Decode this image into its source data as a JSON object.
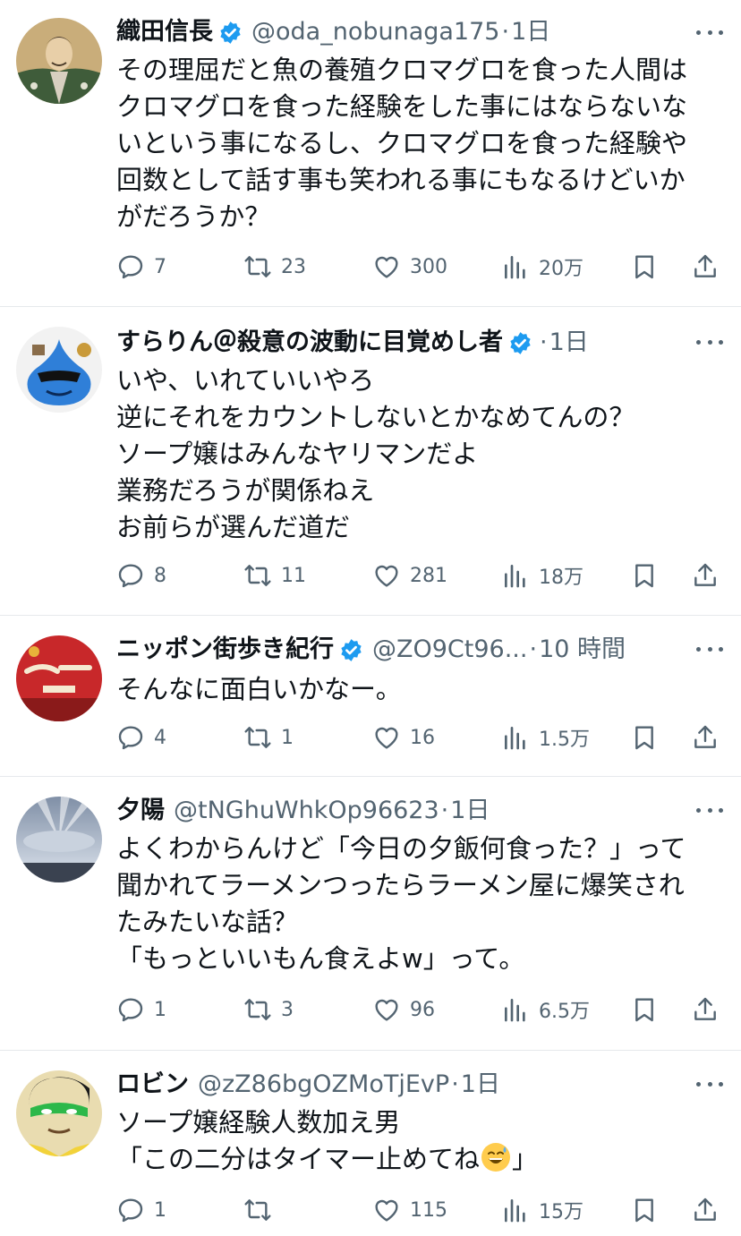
{
  "tweets": [
    {
      "name": "織田信長",
      "verified": true,
      "handle": "@oda_nobunaga175",
      "sep": "·",
      "time": "1日",
      "text": "その理屈だと魚の養殖クロマグロを食った人間は\nクロマグロを食った経験をした事にはならないな\nいという事になるし、クロマグロを食った経験や\n回数として話す事も笑われる事にもなるけどいか\nがだろうか？",
      "replies": "7",
      "retweets": "23",
      "likes": "300",
      "views": "20万",
      "avatar_icon": "samurai-portrait"
    },
    {
      "name": "すらりん＠殺意の波動に目覚めし者",
      "verified": true,
      "handle": "",
      "sep": "·",
      "time": "1日",
      "text": "いや、いれていいやろ\n逆にそれをカウントしないとかなめてんの？\nソープ嬢はみんなヤリマンだよ\n業務だろうが関係ねえ\nお前らが選んだ道だ",
      "replies": "8",
      "retweets": "11",
      "likes": "281",
      "views": "18万",
      "avatar_icon": "blue-slime-with-sunglasses"
    },
    {
      "name": "ニッポン街歩き紀行",
      "verified": true,
      "handle": "@ZO9Ct96...",
      "sep": "·",
      "time": "10 時間",
      "text": "そんなに面白いかなー。",
      "replies": "4",
      "retweets": "1",
      "likes": "16",
      "views": "1.5万",
      "avatar_icon": "red-sign"
    },
    {
      "name": "夕陽",
      "verified": false,
      "handle": "@tNGhuWhkOp96623",
      "sep": "·",
      "time": "1日",
      "text": "よくわからんけど「今日の夕飯何食った？」って\n聞かれてラーメンつったらラーメン屋に爆笑され\nたみたいな話？\n「もっといいもん食えよw」って。",
      "replies": "1",
      "retweets": "3",
      "likes": "96",
      "views": "6.5万",
      "avatar_icon": "sky-sunrays"
    },
    {
      "name": "ロビン",
      "verified": false,
      "handle": "@zZ86bgOZMoTjEvP",
      "sep": "·",
      "time": "1日",
      "text_before_emoji": "ソープ嬢経験人数加え男\n「この二分はタイマー止めてね",
      "emoji": "grinning-sweat-emoji",
      "text_after_emoji": "」",
      "replies": "1",
      "retweets": "",
      "likes": "115",
      "views": "15万",
      "avatar_icon": "masked-cartoon-face"
    }
  ],
  "colors": {
    "text": "#0f1419",
    "muted": "#536471",
    "verified": "#1d9bf0",
    "divider": "#e6e9ec"
  }
}
